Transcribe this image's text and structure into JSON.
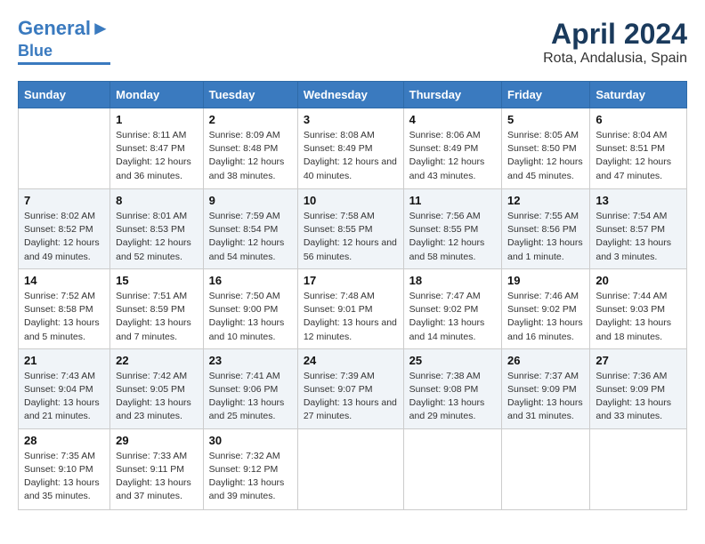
{
  "header": {
    "logo_line1": "General",
    "logo_line2": "Blue",
    "month": "April 2024",
    "location": "Rota, Andalusia, Spain"
  },
  "weekdays": [
    "Sunday",
    "Monday",
    "Tuesday",
    "Wednesday",
    "Thursday",
    "Friday",
    "Saturday"
  ],
  "weeks": [
    [
      {
        "day": "",
        "sunrise": "",
        "sunset": "",
        "daylight": ""
      },
      {
        "day": "1",
        "sunrise": "Sunrise: 8:11 AM",
        "sunset": "Sunset: 8:47 PM",
        "daylight": "Daylight: 12 hours and 36 minutes."
      },
      {
        "day": "2",
        "sunrise": "Sunrise: 8:09 AM",
        "sunset": "Sunset: 8:48 PM",
        "daylight": "Daylight: 12 hours and 38 minutes."
      },
      {
        "day": "3",
        "sunrise": "Sunrise: 8:08 AM",
        "sunset": "Sunset: 8:49 PM",
        "daylight": "Daylight: 12 hours and 40 minutes."
      },
      {
        "day": "4",
        "sunrise": "Sunrise: 8:06 AM",
        "sunset": "Sunset: 8:49 PM",
        "daylight": "Daylight: 12 hours and 43 minutes."
      },
      {
        "day": "5",
        "sunrise": "Sunrise: 8:05 AM",
        "sunset": "Sunset: 8:50 PM",
        "daylight": "Daylight: 12 hours and 45 minutes."
      },
      {
        "day": "6",
        "sunrise": "Sunrise: 8:04 AM",
        "sunset": "Sunset: 8:51 PM",
        "daylight": "Daylight: 12 hours and 47 minutes."
      }
    ],
    [
      {
        "day": "7",
        "sunrise": "Sunrise: 8:02 AM",
        "sunset": "Sunset: 8:52 PM",
        "daylight": "Daylight: 12 hours and 49 minutes."
      },
      {
        "day": "8",
        "sunrise": "Sunrise: 8:01 AM",
        "sunset": "Sunset: 8:53 PM",
        "daylight": "Daylight: 12 hours and 52 minutes."
      },
      {
        "day": "9",
        "sunrise": "Sunrise: 7:59 AM",
        "sunset": "Sunset: 8:54 PM",
        "daylight": "Daylight: 12 hours and 54 minutes."
      },
      {
        "day": "10",
        "sunrise": "Sunrise: 7:58 AM",
        "sunset": "Sunset: 8:55 PM",
        "daylight": "Daylight: 12 hours and 56 minutes."
      },
      {
        "day": "11",
        "sunrise": "Sunrise: 7:56 AM",
        "sunset": "Sunset: 8:55 PM",
        "daylight": "Daylight: 12 hours and 58 minutes."
      },
      {
        "day": "12",
        "sunrise": "Sunrise: 7:55 AM",
        "sunset": "Sunset: 8:56 PM",
        "daylight": "Daylight: 13 hours and 1 minute."
      },
      {
        "day": "13",
        "sunrise": "Sunrise: 7:54 AM",
        "sunset": "Sunset: 8:57 PM",
        "daylight": "Daylight: 13 hours and 3 minutes."
      }
    ],
    [
      {
        "day": "14",
        "sunrise": "Sunrise: 7:52 AM",
        "sunset": "Sunset: 8:58 PM",
        "daylight": "Daylight: 13 hours and 5 minutes."
      },
      {
        "day": "15",
        "sunrise": "Sunrise: 7:51 AM",
        "sunset": "Sunset: 8:59 PM",
        "daylight": "Daylight: 13 hours and 7 minutes."
      },
      {
        "day": "16",
        "sunrise": "Sunrise: 7:50 AM",
        "sunset": "Sunset: 9:00 PM",
        "daylight": "Daylight: 13 hours and 10 minutes."
      },
      {
        "day": "17",
        "sunrise": "Sunrise: 7:48 AM",
        "sunset": "Sunset: 9:01 PM",
        "daylight": "Daylight: 13 hours and 12 minutes."
      },
      {
        "day": "18",
        "sunrise": "Sunrise: 7:47 AM",
        "sunset": "Sunset: 9:02 PM",
        "daylight": "Daylight: 13 hours and 14 minutes."
      },
      {
        "day": "19",
        "sunrise": "Sunrise: 7:46 AM",
        "sunset": "Sunset: 9:02 PM",
        "daylight": "Daylight: 13 hours and 16 minutes."
      },
      {
        "day": "20",
        "sunrise": "Sunrise: 7:44 AM",
        "sunset": "Sunset: 9:03 PM",
        "daylight": "Daylight: 13 hours and 18 minutes."
      }
    ],
    [
      {
        "day": "21",
        "sunrise": "Sunrise: 7:43 AM",
        "sunset": "Sunset: 9:04 PM",
        "daylight": "Daylight: 13 hours and 21 minutes."
      },
      {
        "day": "22",
        "sunrise": "Sunrise: 7:42 AM",
        "sunset": "Sunset: 9:05 PM",
        "daylight": "Daylight: 13 hours and 23 minutes."
      },
      {
        "day": "23",
        "sunrise": "Sunrise: 7:41 AM",
        "sunset": "Sunset: 9:06 PM",
        "daylight": "Daylight: 13 hours and 25 minutes."
      },
      {
        "day": "24",
        "sunrise": "Sunrise: 7:39 AM",
        "sunset": "Sunset: 9:07 PM",
        "daylight": "Daylight: 13 hours and 27 minutes."
      },
      {
        "day": "25",
        "sunrise": "Sunrise: 7:38 AM",
        "sunset": "Sunset: 9:08 PM",
        "daylight": "Daylight: 13 hours and 29 minutes."
      },
      {
        "day": "26",
        "sunrise": "Sunrise: 7:37 AM",
        "sunset": "Sunset: 9:09 PM",
        "daylight": "Daylight: 13 hours and 31 minutes."
      },
      {
        "day": "27",
        "sunrise": "Sunrise: 7:36 AM",
        "sunset": "Sunset: 9:09 PM",
        "daylight": "Daylight: 13 hours and 33 minutes."
      }
    ],
    [
      {
        "day": "28",
        "sunrise": "Sunrise: 7:35 AM",
        "sunset": "Sunset: 9:10 PM",
        "daylight": "Daylight: 13 hours and 35 minutes."
      },
      {
        "day": "29",
        "sunrise": "Sunrise: 7:33 AM",
        "sunset": "Sunset: 9:11 PM",
        "daylight": "Daylight: 13 hours and 37 minutes."
      },
      {
        "day": "30",
        "sunrise": "Sunrise: 7:32 AM",
        "sunset": "Sunset: 9:12 PM",
        "daylight": "Daylight: 13 hours and 39 minutes."
      },
      {
        "day": "",
        "sunrise": "",
        "sunset": "",
        "daylight": ""
      },
      {
        "day": "",
        "sunrise": "",
        "sunset": "",
        "daylight": ""
      },
      {
        "day": "",
        "sunrise": "",
        "sunset": "",
        "daylight": ""
      },
      {
        "day": "",
        "sunrise": "",
        "sunset": "",
        "daylight": ""
      }
    ]
  ]
}
